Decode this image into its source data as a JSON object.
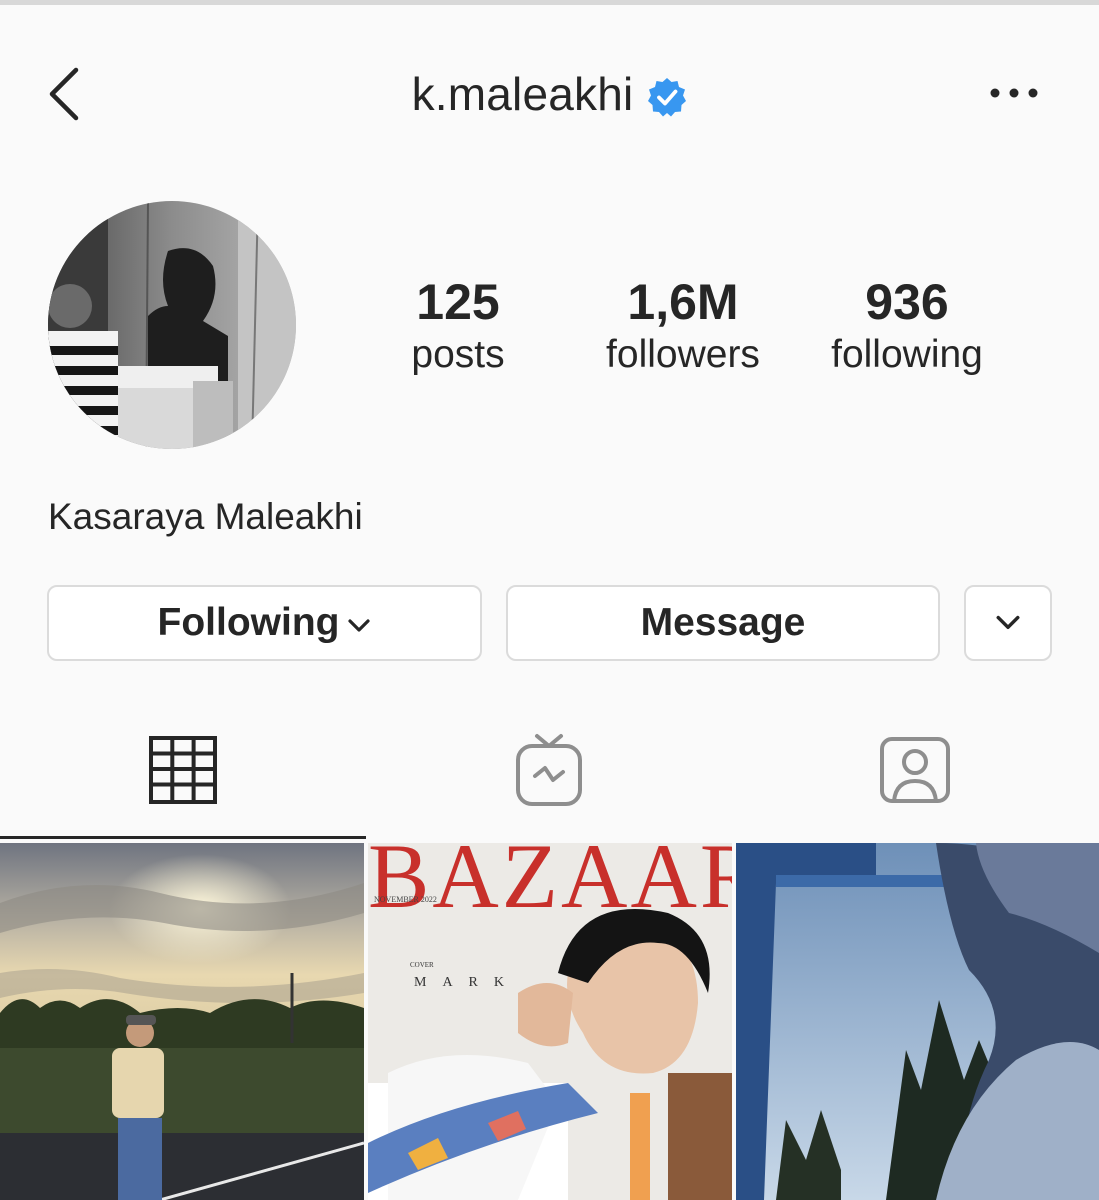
{
  "header": {
    "username": "k.maleakhi",
    "verified": true,
    "back_icon": "chevron-left-icon",
    "more_icon": "more-horizontal-icon"
  },
  "profile": {
    "full_name": "Kasaraya Maleakhi",
    "stats": {
      "posts": {
        "value": "125",
        "label": "posts"
      },
      "followers": {
        "value": "1,6M",
        "label": "followers"
      },
      "following": {
        "value": "936",
        "label": "following"
      }
    }
  },
  "actions": {
    "following_label": "Following",
    "message_label": "Message"
  },
  "tabs": [
    {
      "name": "posts-grid",
      "icon": "grid-icon",
      "active": true
    },
    {
      "name": "igtv",
      "icon": "igtv-icon",
      "active": false
    },
    {
      "name": "tagged",
      "icon": "tagged-person-icon",
      "active": false
    }
  ],
  "posts": [
    {
      "kind": "photo",
      "description_icon": "sunset-photo"
    },
    {
      "kind": "magazine-cover",
      "masthead": "BAZAAR",
      "issue": "NOVEMBER 2022",
      "cover_label": "COVER",
      "cover_name": "MARK"
    },
    {
      "kind": "photo",
      "description_icon": "sky-photo"
    }
  ],
  "colors": {
    "background": "#fafafa",
    "text": "#262626",
    "verified_blue": "#3897f0",
    "border": "#dbdbdb",
    "masthead_red": "#c8302b"
  }
}
